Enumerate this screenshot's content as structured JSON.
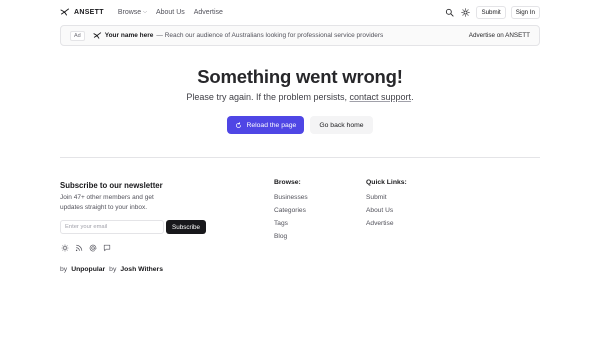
{
  "brand": {
    "name": "ANSETT"
  },
  "nav": [
    {
      "label": "Browse",
      "has_dropdown": true
    },
    {
      "label": "About Us"
    },
    {
      "label": "Advertise"
    }
  ],
  "header_actions": {
    "submit_label": "Submit",
    "signin_label": "Sign In",
    "icons": [
      "search-icon",
      "theme-toggle-icon"
    ]
  },
  "ad": {
    "badge": "Ad",
    "name": "Your name here",
    "text": "— Reach our audience of Australians looking for professional service providers",
    "cta": "Advertise on ANSETT"
  },
  "error": {
    "title": "Something went wrong!",
    "desc_prefix": "Please try again. If the problem persists,",
    "desc_link": "contact support",
    "desc_suffix": ".",
    "reload_label": "Reload the page",
    "back_label": "Go back home"
  },
  "newsletter": {
    "title": "Subscribe to our newsletter",
    "desc": "Join 47+ other members and get updates straight to your inbox.",
    "email_placeholder": "Enter your email",
    "email_value": "",
    "subscribe_label": "Subscribe",
    "social_icons": [
      "theme-icon",
      "rss-icon",
      "at-icon",
      "chat-icon"
    ]
  },
  "footer_columns": [
    {
      "title": "Browse:",
      "links": [
        "Businesses",
        "Categories",
        "Tags",
        "Blog"
      ]
    },
    {
      "title": "Quick Links:",
      "links": [
        "Submit",
        "About Us",
        "Advertise"
      ]
    }
  ],
  "credits": {
    "by1": "by",
    "name1": "Unpopular",
    "by2": "by",
    "name2": "Josh Withers"
  },
  "colors": {
    "primary": "#4f46e5",
    "dark": "#18181b",
    "border": "#e4e4e7",
    "muted": "#52525b"
  }
}
